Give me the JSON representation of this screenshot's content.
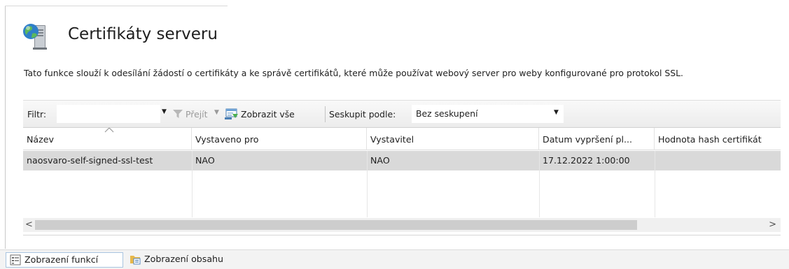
{
  "header": {
    "title": "Certifikáty serveru",
    "icon": "server-certificates-icon",
    "description": "Tato funkce slouží k odesílání žádostí o certifikáty a ke správě certifikátů, které může používat webový server pro weby konfigurované pro protokol SSL."
  },
  "toolbar": {
    "filter_label": "Filtr:",
    "filter_value": "",
    "go_label": "Přejít",
    "show_all_label": "Zobrazit vše",
    "group_by_label": "Seskupit podle:",
    "group_by_value": "Bez seskupení"
  },
  "table": {
    "columns": [
      "Název",
      "Vystaveno pro",
      "Vystavitel",
      "Datum vypršení pl...",
      "Hodnota hash certifikát"
    ],
    "rows": [
      {
        "name": "naosvaro-self-signed-ssl-test",
        "issued_to": "NAO",
        "issuer": "NAO",
        "expiration": "17.12.2022 1:00:00",
        "hash": ""
      }
    ]
  },
  "bottom_tabs": {
    "features_view": "Zobrazení funkcí",
    "content_view": "Zobrazení obsahu"
  },
  "colors": {
    "selected_row": "#d9d9d9",
    "toolbar_bg": "#efefef",
    "active_tab_border": "#a8c4e0"
  }
}
